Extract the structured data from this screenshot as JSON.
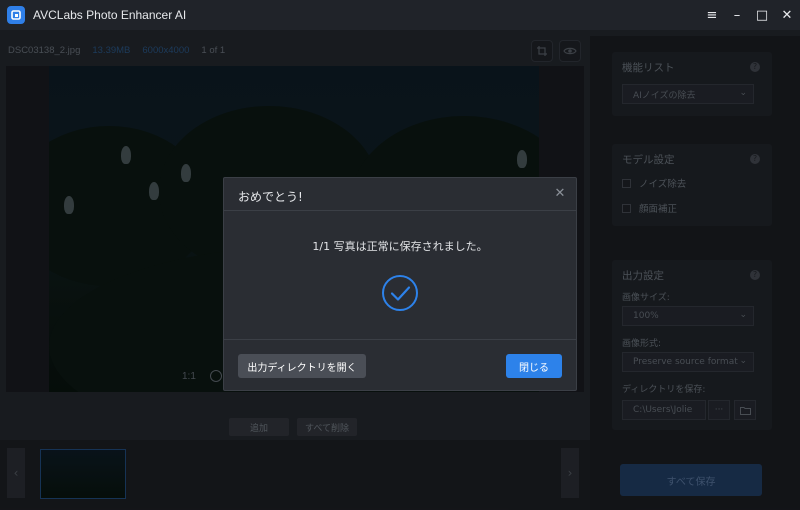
{
  "app": {
    "title": "AVCLabs Photo Enhancer AI",
    "icon": "avclabs-logo-icon",
    "window_controls": {
      "menu_glyph": "≡",
      "minimize_glyph": "–",
      "maximize_glyph": "□",
      "close_glyph": "✕"
    }
  },
  "info_bar": {
    "filename": "DSC03138_2.jpg",
    "filesize": "13.39MB",
    "resolution": "6000x4000",
    "page_count": "1 of 1"
  },
  "preview": {
    "zoom_label": "1:1"
  },
  "bottom_bar": {
    "add_label": "追加",
    "clear_all_label": "すべて削除"
  },
  "thumbnail_strip": {
    "prev_glyph": "‹",
    "next_glyph": "›"
  },
  "right_panel": {
    "feature_list": {
      "title": "機能リスト",
      "selected": "AIノイズの除去"
    },
    "model_settings": {
      "title": "モデル設定",
      "options": [
        "ノイズ除去",
        "顔面補正"
      ]
    },
    "output_settings": {
      "title": "出力設定",
      "image_size_label": "画像サイズ:",
      "image_size_value": "100%",
      "image_format_label": "画像形式:",
      "image_format_value": "Preserve source format",
      "save_dir_label": "ディレクトリを保存:",
      "save_dir_value": "C:\\Users\\Jolie",
      "browse_glyph": "···"
    },
    "save_all_label": "すべて保存"
  },
  "dialog": {
    "title": "おめでとう!",
    "close_glyph": "✕",
    "message": "1/1 写真は正常に保存されました。",
    "open_dir_label": "出力ディレクトリを開く",
    "close_label": "閉じる"
  },
  "colors": {
    "accent": "#2d82ea",
    "background": "#1e2126",
    "dialog_bg": "#2a2d33"
  }
}
